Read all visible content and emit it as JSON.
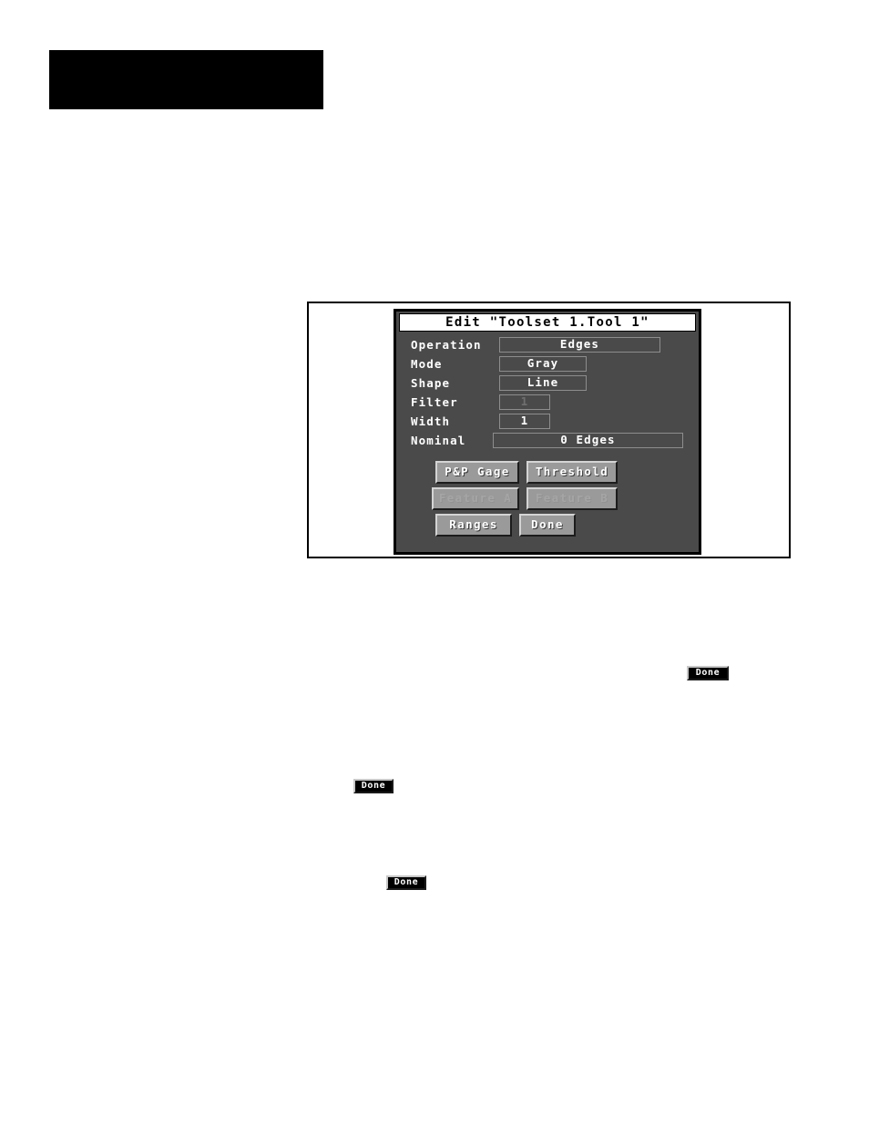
{
  "page": {
    "header_block": {
      "name": "black-header-bar",
      "color": "#000000"
    }
  },
  "figure": {
    "name": "screenshot-figure",
    "frame_color": "#000000",
    "background": "#ffffff"
  },
  "dialog": {
    "title": "Edit \"Toolset 1.Tool 1\"",
    "background": "#4a4a4a",
    "title_background": "#ffffff",
    "title_color": "#000000",
    "fields": [
      {
        "label": "Operation",
        "value": "Edges",
        "enabled": true
      },
      {
        "label": "Mode",
        "value": "Gray",
        "enabled": true
      },
      {
        "label": "Shape",
        "value": "Line",
        "enabled": true
      },
      {
        "label": "Filter",
        "value": "1",
        "enabled": false
      },
      {
        "label": "Width",
        "value": "1",
        "enabled": true
      },
      {
        "label": "Nominal",
        "value": "0 Edges",
        "enabled": true
      }
    ],
    "buttons": [
      {
        "label": "P&P Gage",
        "enabled": true
      },
      {
        "label": "Threshold",
        "enabled": true
      },
      {
        "label": "Feature A",
        "enabled": false
      },
      {
        "label": "Feature B",
        "enabled": false
      },
      {
        "label": "Ranges",
        "enabled": true
      },
      {
        "label": "Done",
        "enabled": true
      }
    ]
  },
  "inline_buttons": [
    {
      "label": "Done"
    },
    {
      "label": "Done"
    },
    {
      "label": "Done"
    }
  ]
}
